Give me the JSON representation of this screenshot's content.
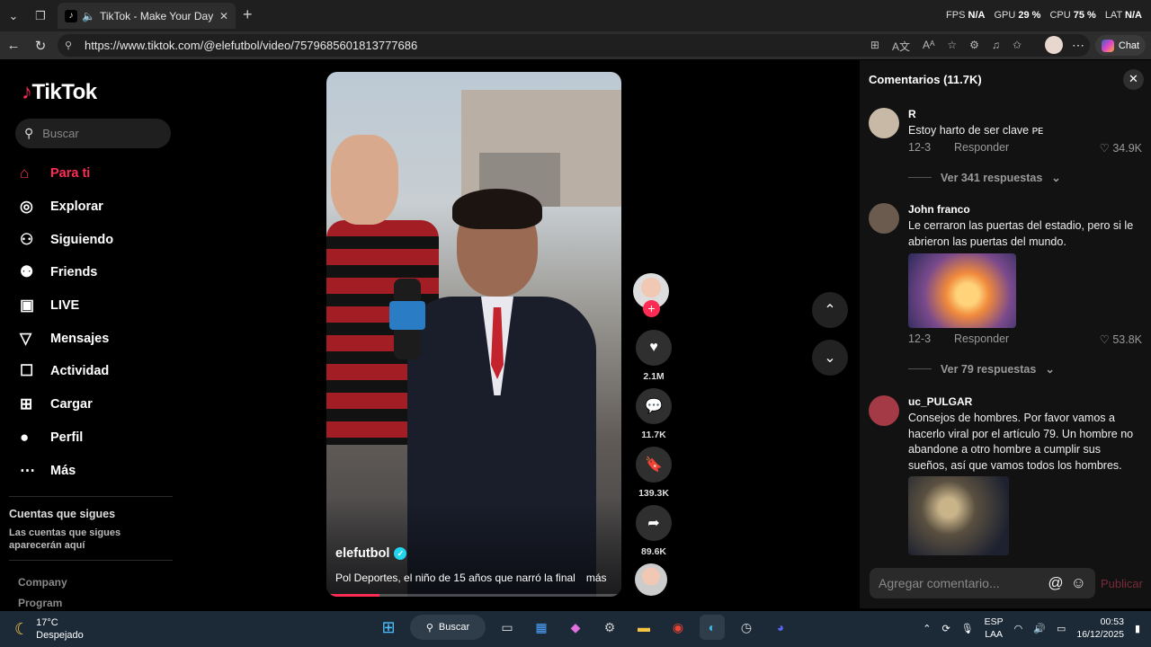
{
  "browser": {
    "tab_title": "TikTok - Make Your Day",
    "url": "https://www.tiktok.com/@elefutbol/video/7579685601813777686",
    "chat_label": "Chat",
    "perf": {
      "fps_label": "FPS",
      "fps": "N/A",
      "gpu_label": "GPU",
      "gpu": "29 %",
      "cpu_label": "CPU",
      "cpu": "75 %",
      "lat_label": "LAT",
      "lat": "N/A"
    }
  },
  "sidebar": {
    "logo": "TikTok",
    "search_placeholder": "Buscar",
    "items": [
      {
        "label": "Para ti",
        "icon": "home-icon",
        "active": true
      },
      {
        "label": "Explorar",
        "icon": "compass-icon"
      },
      {
        "label": "Siguiendo",
        "icon": "following-icon"
      },
      {
        "label": "Friends",
        "icon": "friends-icon"
      },
      {
        "label": "LIVE",
        "icon": "live-icon"
      },
      {
        "label": "Mensajes",
        "icon": "messages-icon"
      },
      {
        "label": "Actividad",
        "icon": "activity-icon"
      },
      {
        "label": "Cargar",
        "icon": "upload-icon"
      },
      {
        "label": "Perfil",
        "icon": "profile-icon"
      },
      {
        "label": "Más",
        "icon": "more-icon"
      }
    ],
    "following_title": "Cuentas que sigues",
    "following_sub": "Las cuentas que sigues aparecerán aquí",
    "footer": [
      "Company",
      "Program"
    ]
  },
  "video": {
    "username": "elefutbol",
    "caption": "Pol Deportes, el niño de 15 años que narró la final",
    "more": "más",
    "progress": 0.18
  },
  "actions": {
    "likes": "2.1M",
    "comments": "11.7K",
    "saves": "139.3K",
    "shares": "89.6K"
  },
  "comments_panel": {
    "title": "Comentarios (11.7K)",
    "reply_label": "Responder",
    "comments": [
      {
        "name": "R",
        "text": "Estoy harto de ser clave ᴘᴇ",
        "date": "12-3",
        "likes": "34.9K",
        "replies": "Ver 341 respuestas"
      },
      {
        "name": "John franco",
        "text": "Le cerraron las puertas del estadio, pero si le abrieron las puertas del mundo.",
        "date": "12-3",
        "likes": "53.8K",
        "replies": "Ver 79 respuestas"
      },
      {
        "name": "uc_PULGAR",
        "text": "Consejos de hombres. Por favor vamos a hacerlo viral por el artículo 79. Un hombre no abandone a otro hombre a cumplir sus sueños, así que vamos todos los hombres."
      }
    ],
    "input_placeholder": "Agregar comentario...",
    "publish": "Publicar"
  },
  "taskbar": {
    "temp": "17°C",
    "weather": "Despejado",
    "search": "Buscar",
    "lang1": "ESP",
    "lang2": "LAA",
    "time": "00:53",
    "date": "16/12/2025"
  },
  "colors": {
    "accent": "#fe2c55",
    "verified": "#20d5ec"
  }
}
